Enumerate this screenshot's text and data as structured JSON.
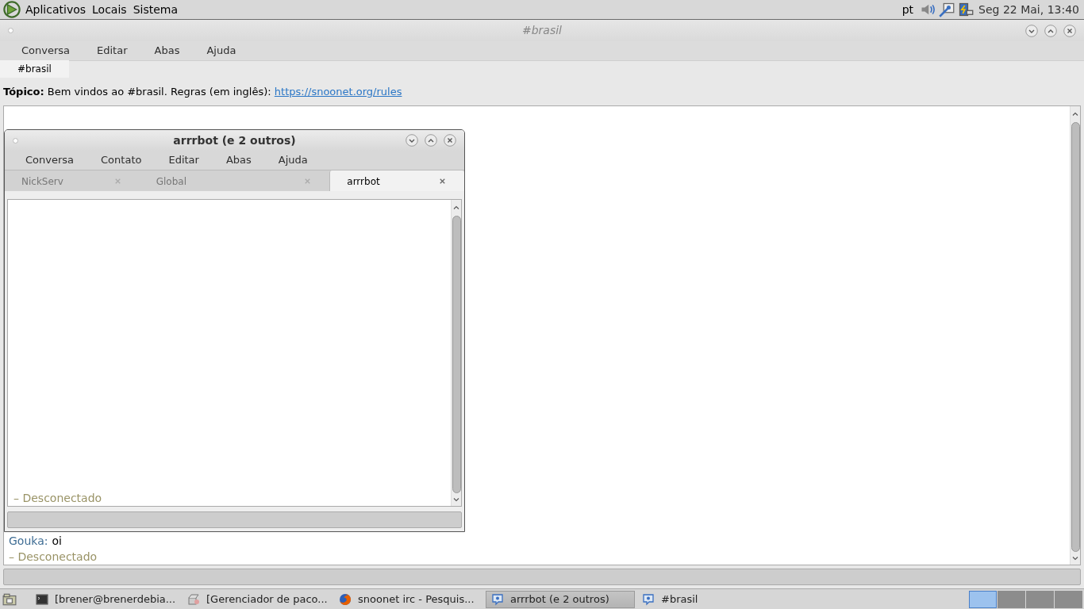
{
  "top_panel": {
    "menus": [
      "Aplicativos",
      "Locais",
      "Sistema"
    ],
    "keyboard_layout": "pt",
    "clock": "Seg 22 Mai, 13:40"
  },
  "main_window": {
    "title": "#brasil",
    "menu": [
      "Conversa",
      "Editar",
      "Abas",
      "Ajuda"
    ],
    "tabs": [
      {
        "label": "#brasil",
        "selected": true
      }
    ],
    "topic": {
      "label": "Tópico:",
      "text": "Bem vindos ao #brasil. Regras (em inglês):",
      "link": "https://snoonet.org/rules"
    },
    "messages": [
      {
        "kind": "chat",
        "nick": "Gouka:",
        "text": "oi"
      },
      {
        "kind": "status",
        "text": "– Desconectado"
      }
    ]
  },
  "conversation_window": {
    "title": "arrrbot (e 2 outros)",
    "menu": [
      "Conversa",
      "Contato",
      "Editar",
      "Abas",
      "Ajuda"
    ],
    "tabs": [
      {
        "label": "NickServ",
        "selected": false
      },
      {
        "label": "Global",
        "selected": false
      },
      {
        "label": "arrrbot",
        "selected": true
      }
    ],
    "messages": [
      {
        "kind": "status",
        "text": "– Desconectado"
      }
    ]
  },
  "taskbar": {
    "items": [
      {
        "kind": "terminal",
        "label": "[brener@brenerdebia...",
        "selected": false
      },
      {
        "kind": "package",
        "label": "[Gerenciador de paco...",
        "selected": false
      },
      {
        "kind": "browser",
        "label": "snoonet irc - Pesquis...",
        "selected": false
      },
      {
        "kind": "chat",
        "label": "arrrbot (e 2 outros)",
        "selected": true
      },
      {
        "kind": "chat",
        "label": "#brasil",
        "selected": false
      }
    ],
    "workspaces": [
      {
        "selected": true
      },
      {
        "selected": false
      },
      {
        "selected": false
      },
      {
        "selected": false
      }
    ]
  }
}
